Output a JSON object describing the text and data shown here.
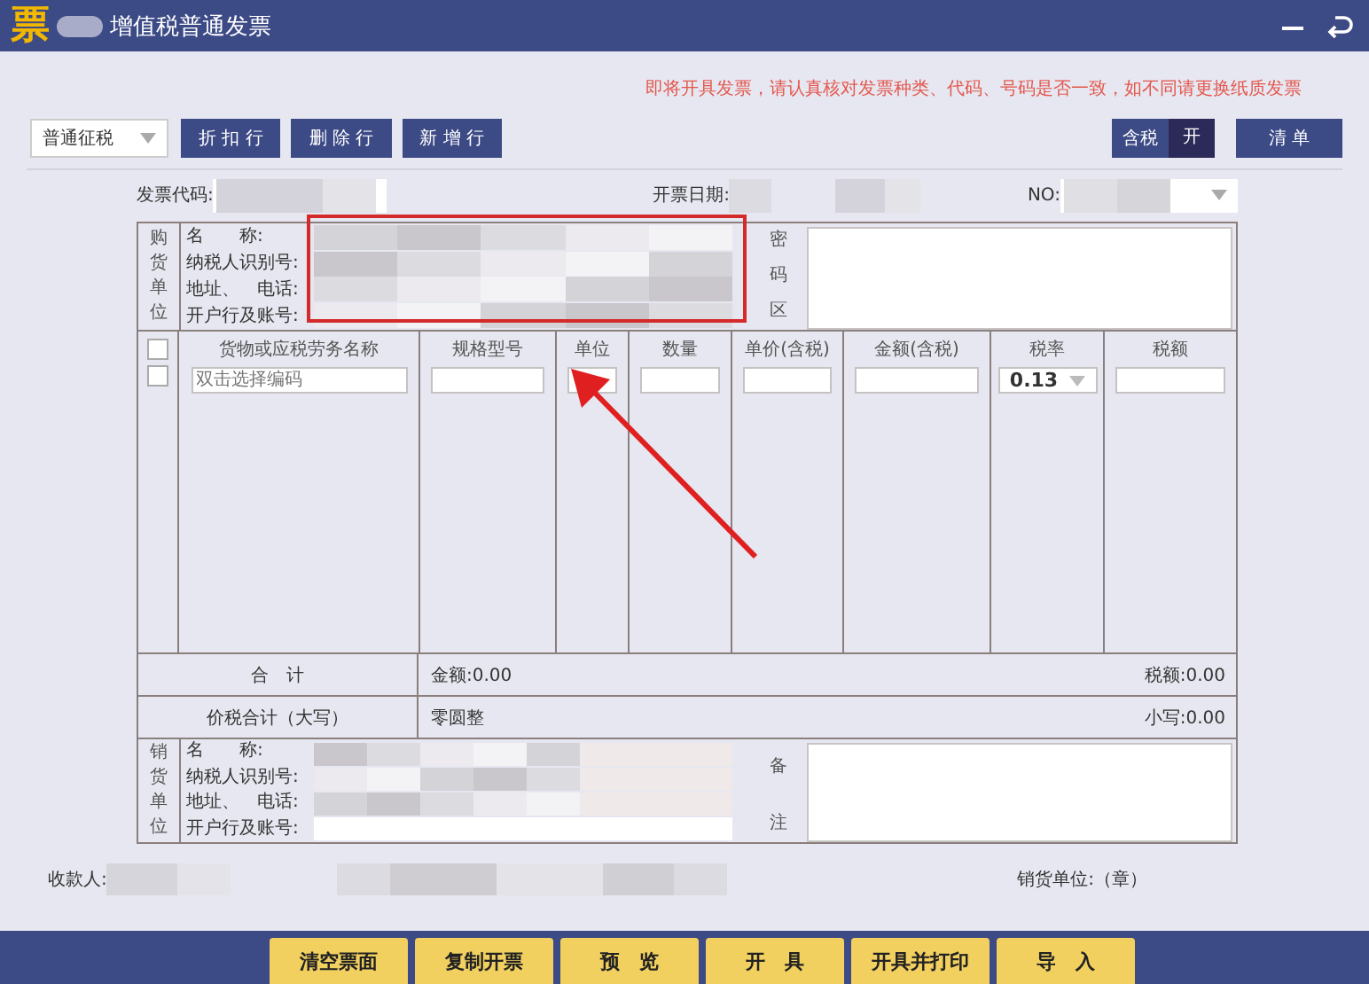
{
  "window": {
    "logo": "票",
    "title": "增值税普通发票"
  },
  "notice": "即将开具发票，请认真核对发票种类、代码、号码是否一致，如不同请更换纸质发票",
  "toolbar": {
    "levy_type": "普通征税",
    "buttons": [
      "折 扣 行",
      "删 除 行",
      "新 增 行"
    ],
    "tax_included": {
      "label": "含税",
      "state": "开"
    },
    "list_button": "清 单"
  },
  "header": {
    "code_label": "发票代码:",
    "date_label": "开票日期:",
    "no_label": "NO:"
  },
  "buyer": {
    "side_label": "购货单位",
    "fields": [
      "名　　称:",
      "纳税人识别号:",
      "地址、　电话:",
      "开户行及账号:"
    ],
    "cipher_label": "密码区"
  },
  "items": {
    "columns": [
      "货物或应税劳务名称",
      "规格型号",
      "单位",
      "数量",
      "单价(含税)",
      "金额(含税)",
      "税率",
      "税额"
    ],
    "checkboxes": [
      {
        "checked": false
      },
      {
        "checked": false
      }
    ],
    "name_placeholder": "双击选择编码",
    "tax_rate": "0.13"
  },
  "totals": {
    "label": "合　计",
    "amount": "金额:0.00",
    "tax": "税额:0.00"
  },
  "grand_total": {
    "label": "价税合计（大写）",
    "words": "零圆整",
    "small": "小写:0.00"
  },
  "seller": {
    "side_label": "销货单位",
    "fields": [
      "名　　称:",
      "纳税人识别号:",
      "地址、　电话:",
      "开户行及账号:"
    ],
    "remark_top": "备",
    "remark_bottom": "注"
  },
  "footer": {
    "payee_label": "收款人:",
    "seller_unit": "销货单位:（章）"
  },
  "actions": [
    "清空票面",
    "复制开票",
    "预　览",
    "开　具",
    "开具并打印",
    "导　入"
  ]
}
